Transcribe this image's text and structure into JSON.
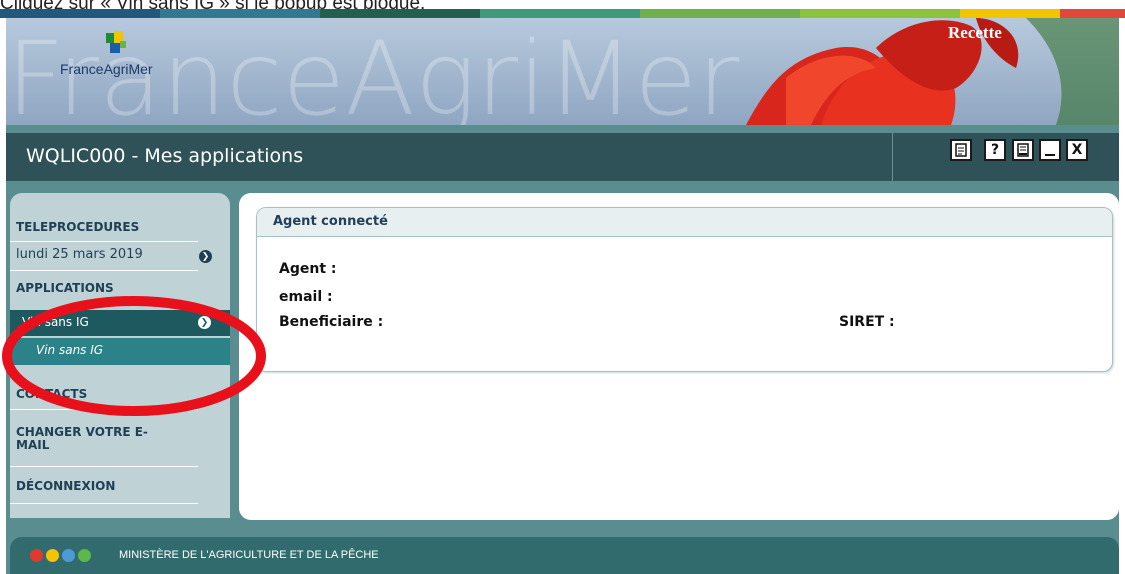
{
  "instruction": "Cliquez sur « Vin sans IG » si le popup est bloqué.",
  "color_strip": [
    "#1f5a7a",
    "#2f7a8e",
    "#245e4d",
    "#3d9a7a",
    "#6fb04a",
    "#8cc23c",
    "#f2c500",
    "#e0493a"
  ],
  "banner": {
    "wordmark": "FranceAgriMer",
    "logo_text": "FranceAgriMer",
    "environment": "Recette"
  },
  "title_bar": {
    "title": "WQLIC000 - Mes applications",
    "icons": [
      "print-icon",
      "help-icon",
      "document-icon",
      "minimize-icon",
      "close-icon"
    ],
    "help_glyph": "?",
    "close_glyph": "X"
  },
  "sidebar": {
    "teleprocedures": "TELEPROCEDURES",
    "date": "lundi 25 mars 2019",
    "applications": "APPLICATIONS",
    "selected_app": "Vin sans IG",
    "sub_app": "Vin sans IG",
    "contacts": "CONTACTS",
    "change_email": "CHANGER VOTRE E-MAIL",
    "logout": "DÉCONNEXION"
  },
  "panel": {
    "header": "Agent connecté",
    "agent_label": "Agent :",
    "email_label": "email :",
    "beneficiaire_label": "Beneficiaire :",
    "siret_label": "SIRET :"
  },
  "footer": {
    "text": "MINISTÈRE DE L'AGRICULTURE ET DE LA PÊCHE",
    "dot_colors": [
      "#e03a2e",
      "#f2c500",
      "#4a9bd6",
      "#5cb84a"
    ]
  },
  "colors": {
    "frame": "#5a8d8f",
    "title_bar": "#2e5257",
    "sidebar_bg": "#bfd3d7",
    "selected_item": "#1f5960",
    "sub_item": "#2c8289",
    "annotation": "#e8101a"
  }
}
